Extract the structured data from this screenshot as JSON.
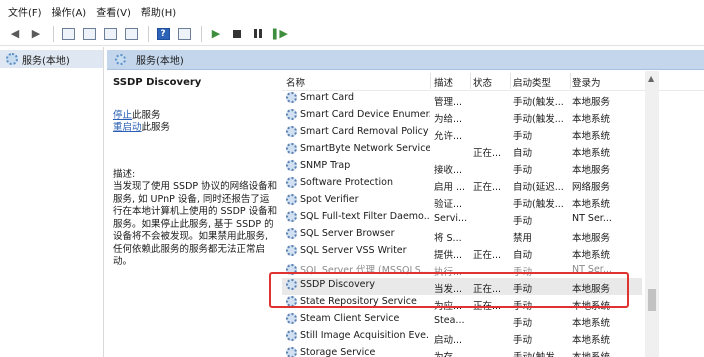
{
  "menu": [
    "文件(F)",
    "操作(A)",
    "查看(V)",
    "帮助(H)"
  ],
  "toolbar": {
    "icons": [
      "back-arrow-icon",
      "forward-arrow-icon",
      "console-tree-icon",
      "properties-icon",
      "refresh-icon",
      "export-icon",
      "help-icon",
      "view-icon",
      "start-service-icon",
      "stop-service-icon",
      "pause-service-icon",
      "restart-service-icon"
    ]
  },
  "tree": {
    "root_label": "服务(本地)"
  },
  "content": {
    "header": "服务(本地)"
  },
  "detail": {
    "title": "SSDP Discovery",
    "stop_link": "停止",
    "stop_suffix": "此服务",
    "restart_link": "重启动",
    "restart_suffix": "此服务",
    "desc_label": "描述:",
    "desc_text": "当发现了使用 SSDP 协议的网络设备和服务, 如 UPnP 设备, 同时还报告了运行在本地计算机上使用的 SSDP 设备和服务。如果停止此服务, 基于 SSDP 的设备将不会被发现。如果禁用此服务, 任何依赖此服务的服务都无法正常启动。"
  },
  "list": {
    "columns": [
      "名称",
      "描述",
      "状态",
      "启动类型",
      "登录为"
    ],
    "rows": [
      {
        "name": "Smart Card",
        "desc": "管理...",
        "status": "",
        "type": "手动(触发...",
        "login": "本地服务"
      },
      {
        "name": "Smart Card Device Enumer...",
        "desc": "为给...",
        "status": "",
        "type": "手动(触发...",
        "login": "本地系统"
      },
      {
        "name": "Smart Card Removal Policy",
        "desc": "允许...",
        "status": "",
        "type": "手动",
        "login": "本地系统"
      },
      {
        "name": "SmartByte Network Service",
        "desc": "",
        "status": "正在...",
        "type": "自动",
        "login": "本地系统"
      },
      {
        "name": "SNMP Trap",
        "desc": "接收...",
        "status": "",
        "type": "手动",
        "login": "本地服务"
      },
      {
        "name": "Software Protection",
        "desc": "启用 ...",
        "status": "正在...",
        "type": "自动(延迟...",
        "login": "网络服务"
      },
      {
        "name": "Spot Verifier",
        "desc": "验证...",
        "status": "",
        "type": "手动(触发...",
        "login": "本地系统"
      },
      {
        "name": "SQL Full-text Filter Daemo...",
        "desc": "Servi...",
        "status": "",
        "type": "手动",
        "login": "NT Ser..."
      },
      {
        "name": "SQL Server Browser",
        "desc": "将 S...",
        "status": "",
        "type": "禁用",
        "login": "本地服务"
      },
      {
        "name": "SQL Server VSS Writer",
        "desc": "提供...",
        "status": "正在...",
        "type": "自动",
        "login": "本地系统"
      },
      {
        "name": "SQL Server 代理 (MSSQLS...",
        "desc": "执行...",
        "status": "",
        "type": "手动",
        "login": "NT Ser..."
      },
      {
        "name": "SSDP Discovery",
        "desc": "当发...",
        "status": "正在...",
        "type": "手动",
        "login": "本地服务"
      },
      {
        "name": "State Repository Service",
        "desc": "为应...",
        "status": "正在...",
        "type": "手动",
        "login": "本地系统"
      },
      {
        "name": "Steam Client Service",
        "desc": "Stea...",
        "status": "",
        "type": "手动",
        "login": "本地系统"
      },
      {
        "name": "Still Image Acquisition Eve...",
        "desc": "启动...",
        "status": "",
        "type": "手动",
        "login": "本地系统"
      },
      {
        "name": "Storage Service",
        "desc": "为存...",
        "status": "",
        "type": "手动(触发...",
        "login": "本地系统"
      }
    ]
  },
  "colors": {
    "highlight": "#e0322f",
    "header_bg": "#c4d6ec",
    "link": "#2a5fb5"
  }
}
